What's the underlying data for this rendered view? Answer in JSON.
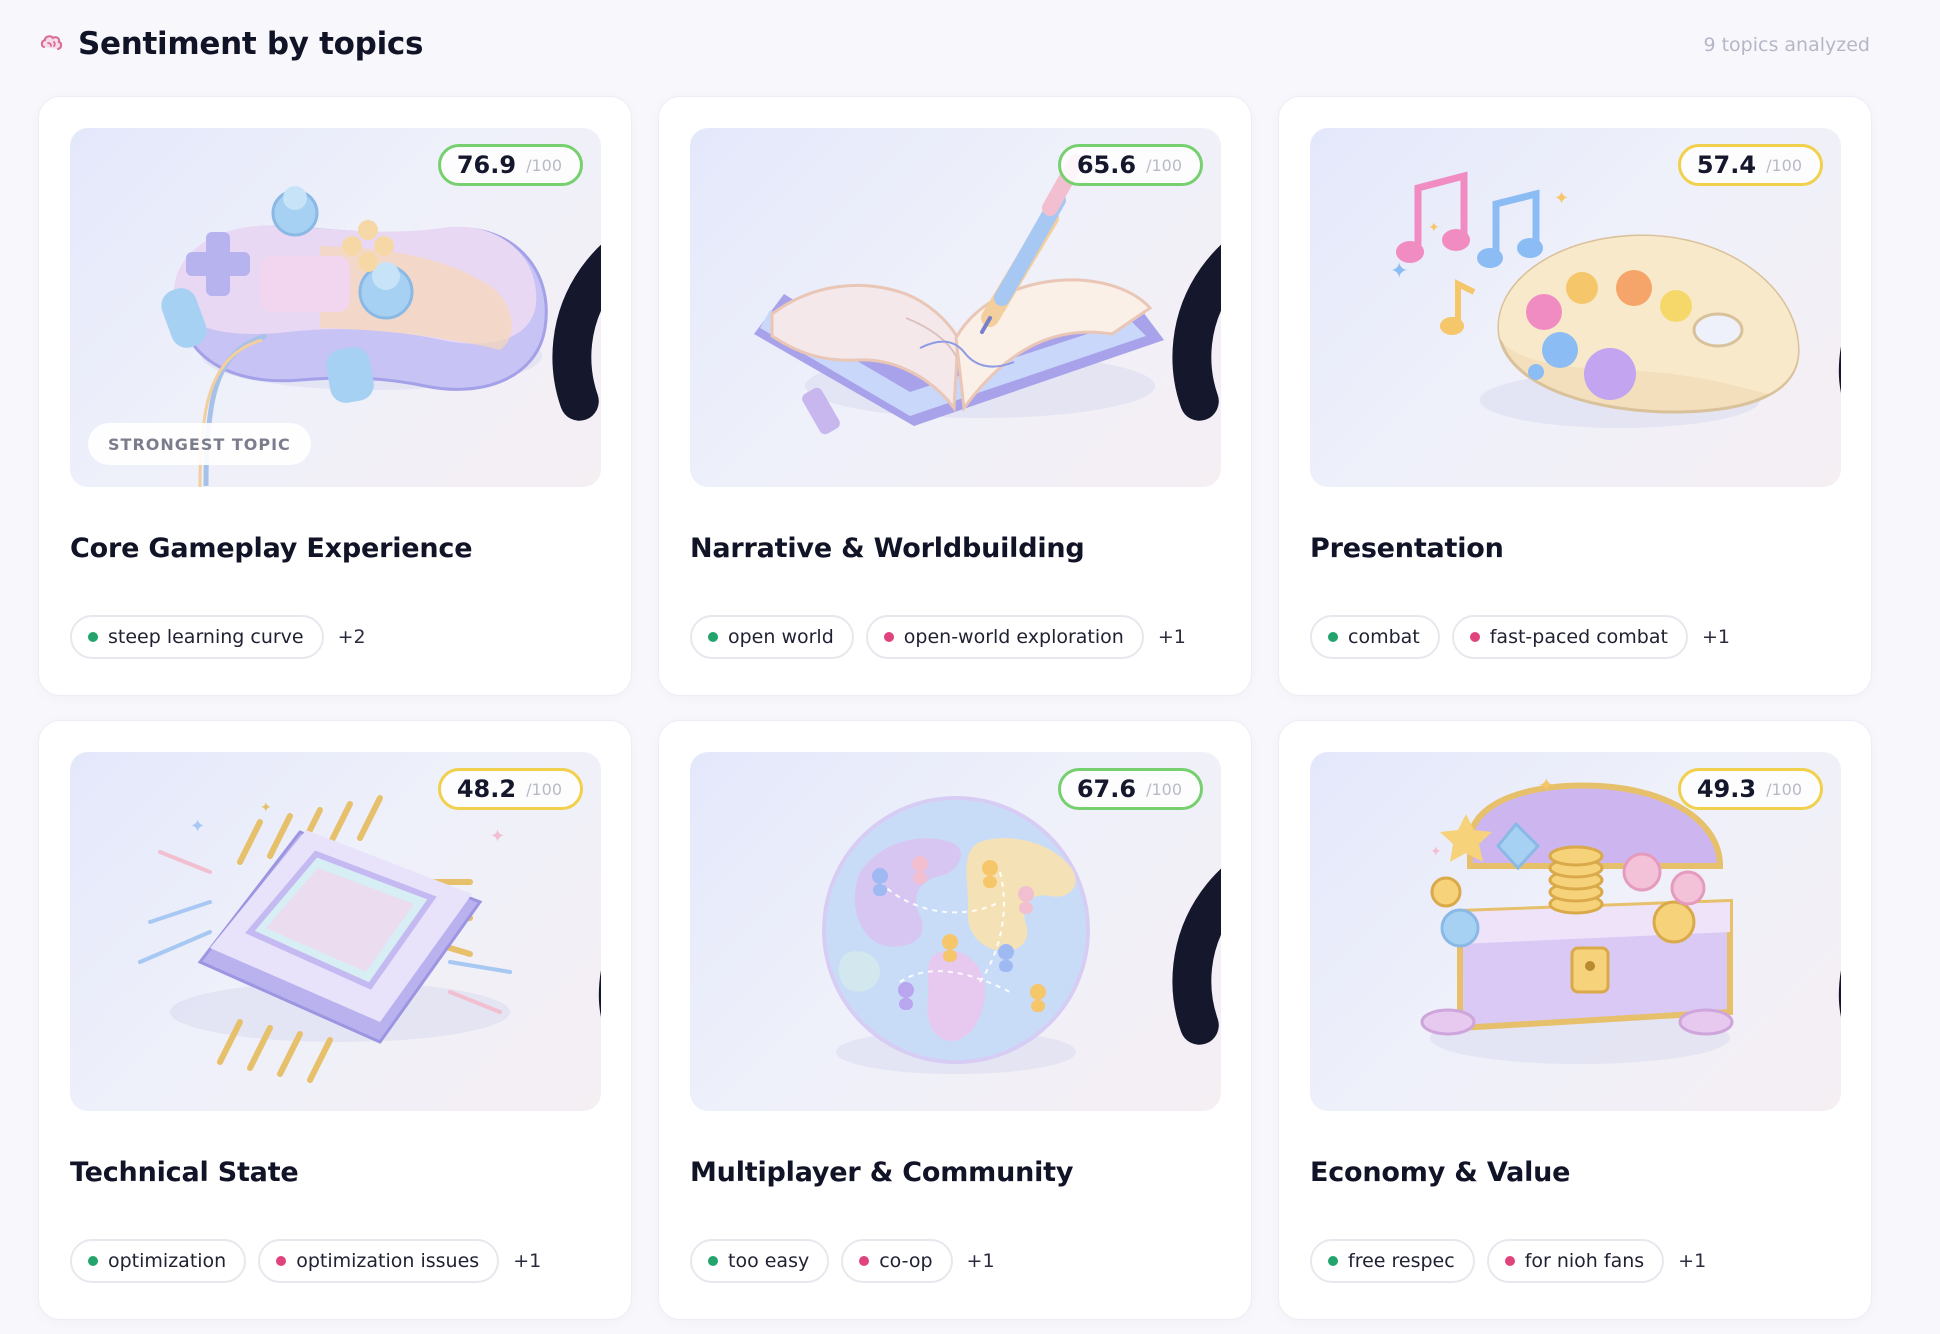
{
  "header": {
    "title": "Sentiment by topics",
    "count_text": "9 topics analyzed",
    "icon": "brain-icon"
  },
  "colors": {
    "positive": "#22a46c",
    "negative": "#e0447c",
    "score_high": "#77d06f",
    "score_mid": "#f0d04c"
  },
  "cards": [
    {
      "title": "Core Gameplay Experience",
      "score": "76.9",
      "score_max": "/100",
      "score_level": "high",
      "image": "game-controller-image",
      "badge": "STRONGEST TOPIC",
      "tags": [
        {
          "label": "steep learning curve",
          "sentiment": "positive"
        }
      ],
      "more": "+2"
    },
    {
      "title": "Narrative & Worldbuilding",
      "score": "65.6",
      "score_max": "/100",
      "score_level": "high",
      "image": "open-book-image",
      "tags": [
        {
          "label": "open world",
          "sentiment": "positive"
        },
        {
          "label": "open-world exploration",
          "sentiment": "negative"
        }
      ],
      "more": "+1"
    },
    {
      "title": "Presentation",
      "score": "57.4",
      "score_max": "/100",
      "score_level": "mid",
      "image": "music-palette-image",
      "tags": [
        {
          "label": "combat",
          "sentiment": "positive"
        },
        {
          "label": "fast-paced combat",
          "sentiment": "negative"
        }
      ],
      "more": "+1"
    },
    {
      "title": "Technical State",
      "score": "48.2",
      "score_max": "/100",
      "score_level": "mid",
      "image": "chip-image",
      "tags": [
        {
          "label": "optimization",
          "sentiment": "positive"
        },
        {
          "label": "optimization issues",
          "sentiment": "negative"
        }
      ],
      "more": "+1"
    },
    {
      "title": "Multiplayer & Community",
      "score": "67.6",
      "score_max": "/100",
      "score_level": "high",
      "image": "globe-image",
      "tags": [
        {
          "label": "too easy",
          "sentiment": "positive"
        },
        {
          "label": "co-op",
          "sentiment": "negative"
        }
      ],
      "more": "+1"
    },
    {
      "title": "Economy & Value",
      "score": "49.3",
      "score_max": "/100",
      "score_level": "mid",
      "image": "treasure-chest-image",
      "tags": [
        {
          "label": "free respec",
          "sentiment": "positive"
        },
        {
          "label": "for nioh fans",
          "sentiment": "negative"
        }
      ],
      "more": "+1"
    }
  ]
}
